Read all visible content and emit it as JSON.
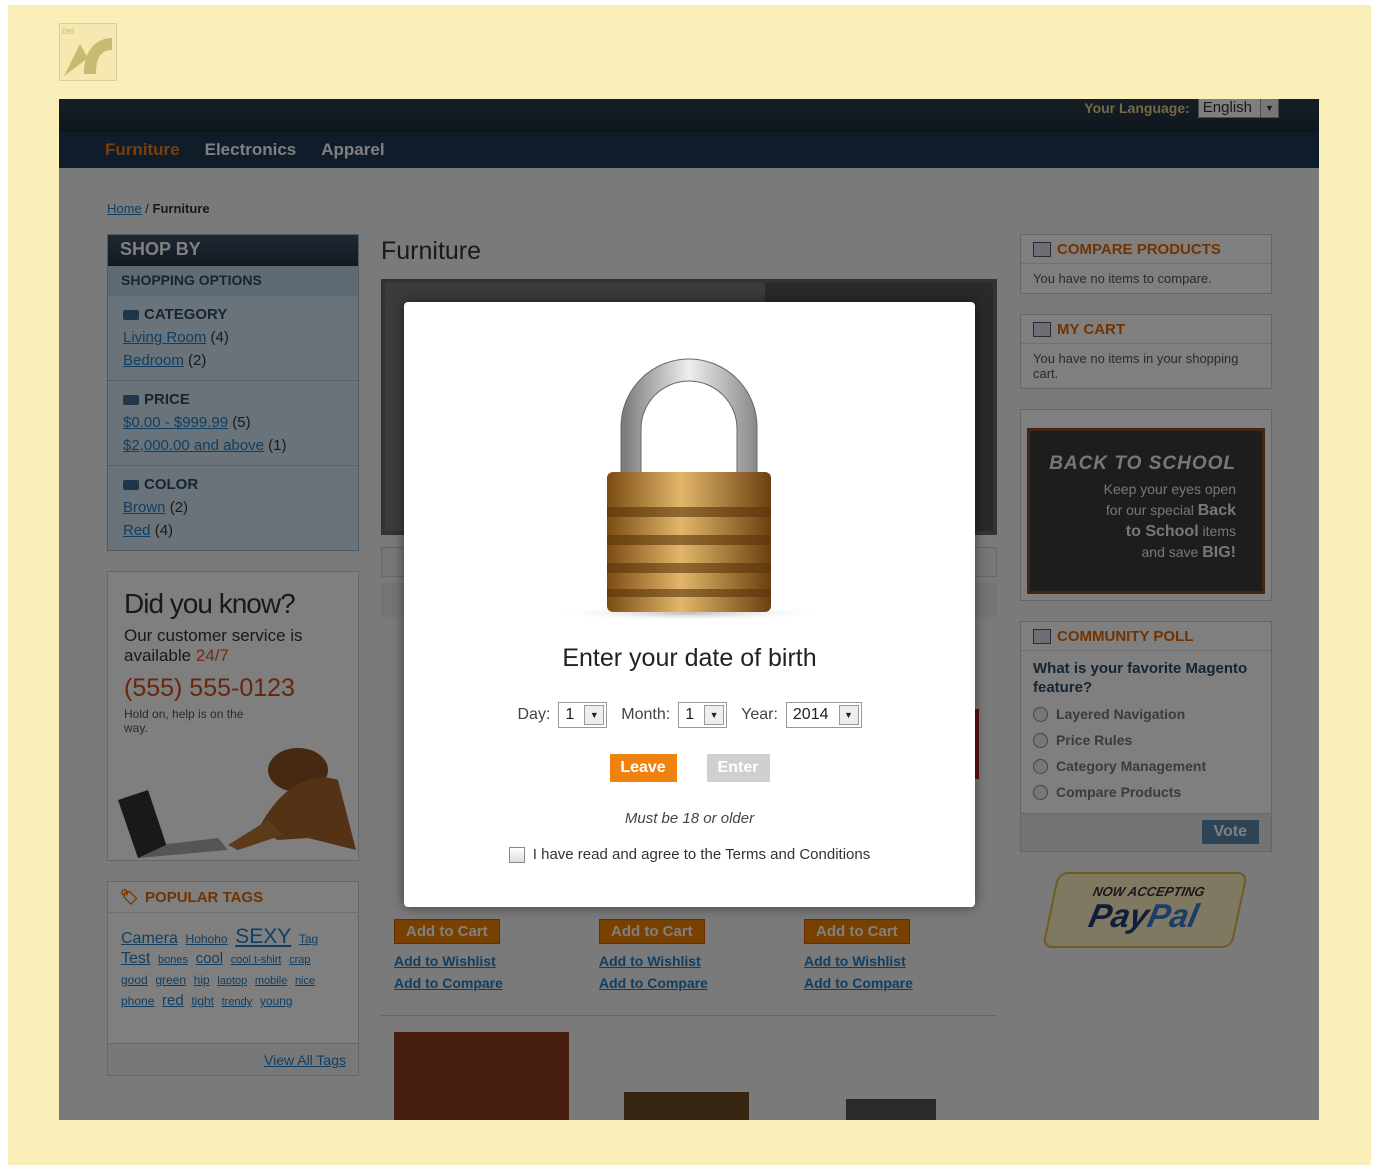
{
  "header": {
    "language_label": "Your Language:",
    "language_value": "English"
  },
  "nav": [
    "Furniture",
    "Electronics",
    "Apparel"
  ],
  "breadcrumb": {
    "home": "Home",
    "sep": " / ",
    "current": "Furniture"
  },
  "shop_by": {
    "title": "SHOP BY",
    "subtitle": "SHOPPING OPTIONS",
    "filters": [
      {
        "title": "CATEGORY",
        "options": [
          {
            "label": "Living Room",
            "count": "(4)"
          },
          {
            "label": "Bedroom",
            "count": "(2)"
          }
        ]
      },
      {
        "title": "PRICE",
        "options": [
          {
            "label": "$0.00 - $999.99",
            "count": "(5)"
          },
          {
            "label": "$2,000.00 and above",
            "count": "(1)"
          }
        ]
      },
      {
        "title": "COLOR",
        "options": [
          {
            "label": "Brown",
            "count": "(2)"
          },
          {
            "label": "Red",
            "count": "(4)"
          }
        ]
      }
    ]
  },
  "didyouknow": {
    "title": "Did you know?",
    "line1": "Our customer service is",
    "line2a": "available ",
    "line2b": "24/7",
    "phone": "(555) 555-0123",
    "hold": "Hold on, help is on the way."
  },
  "tags": {
    "title": "POPULAR TAGS",
    "items": [
      "Camera",
      "Hohoho",
      "SEXY",
      "Tag",
      "Test",
      "bones",
      "cool",
      "cool t-shirt",
      "crap",
      "good",
      "green",
      "hip",
      "laptop",
      "mobile",
      "nice",
      "phone",
      "red",
      "tight",
      "trendy",
      "young"
    ],
    "view_all": "View All Tags"
  },
  "main": {
    "title": "Furniture"
  },
  "products": {
    "add_to_cart": "Add to Cart",
    "add_to_wishlist": "Add to Wishlist",
    "add_to_compare": "Add to Compare"
  },
  "right": {
    "compare_title": "COMPARE PRODUCTS",
    "compare_text": "You have no items to compare.",
    "cart_title": "MY CART",
    "cart_text": "You have no items in your shopping cart.",
    "promo_title": "BACK TO SCHOOL",
    "promo_l1": "Keep your eyes open",
    "promo_l2a": "for our special ",
    "promo_l2b": "Back",
    "promo_l3a": "to School",
    "promo_l3b": " items",
    "promo_l4a": "and save ",
    "promo_l4b": "BIG!",
    "poll_title": "COMMUNITY POLL",
    "poll_question": "What is your favorite Magento feature?",
    "poll_options": [
      "Layered Navigation",
      "Price Rules",
      "Category Management",
      "Compare Products"
    ],
    "vote": "Vote",
    "paypal_top": "NOW ACCEPTING",
    "paypal_a": "Pay",
    "paypal_b": "Pal"
  },
  "modal": {
    "title": "Enter your date of birth",
    "day_label": "Day:",
    "day_value": "1",
    "month_label": "Month:",
    "month_value": "1",
    "year_label": "Year:",
    "year_value": "2014",
    "leave": "Leave",
    "enter": "Enter",
    "note": "Must be 18 or older",
    "terms": "I have read and agree to the Terms and Conditions"
  }
}
